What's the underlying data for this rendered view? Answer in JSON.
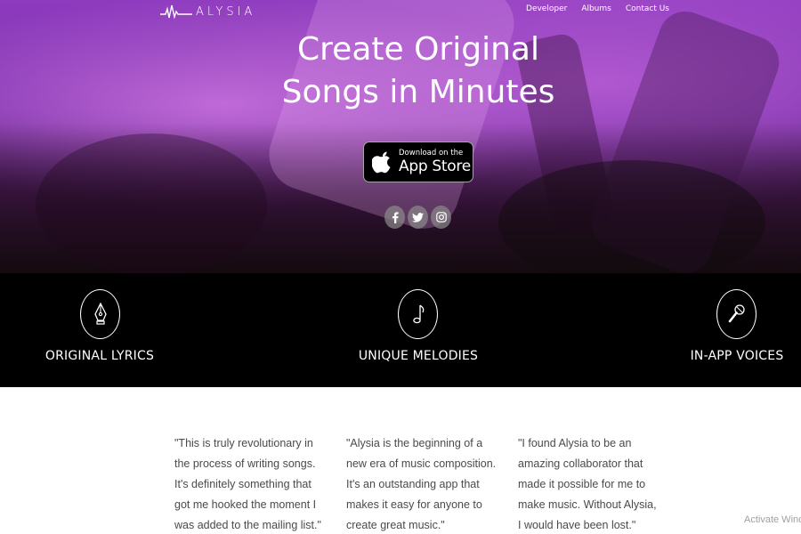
{
  "brand": {
    "name": "ALYSIA"
  },
  "nav": {
    "items": [
      "Developer",
      "Albums",
      "Contact Us"
    ]
  },
  "hero": {
    "title_line1": "Create Original",
    "title_line2": "Songs in Minutes",
    "appstore_small": "Download on the",
    "appstore_big": "App Store"
  },
  "social": [
    {
      "icon": "facebook-icon",
      "glyph": "f"
    },
    {
      "icon": "twitter-icon",
      "glyph": "t"
    },
    {
      "icon": "instagram-icon",
      "glyph": "ig"
    }
  ],
  "features": [
    {
      "label": "ORIGINAL LYRICS",
      "icon": "pen-nib-icon"
    },
    {
      "label": "UNIQUE MELODIES",
      "icon": "music-note-icon"
    },
    {
      "label": "IN-APP VOICES",
      "icon": "microphone-icon"
    }
  ],
  "testimonials": [
    "\"This is truly revolutionary in the process of writing songs. It's definitely something that got me hooked the moment I was added to the mailing list.\"",
    "\"Alysia is the beginning of a new era of music composition. It's an outstanding app that makes it easy for anyone to create great music.\"",
    "\"I found Alysia to be an amazing collaborator that made it possible for me to make music. Without Alysia, I would have been lost.\""
  ],
  "watermark": "Activate Windows",
  "colors": {
    "hero_purple": "#8e3bbf",
    "feature_bg": "#000000",
    "text_gray": "#4a4a4a"
  }
}
